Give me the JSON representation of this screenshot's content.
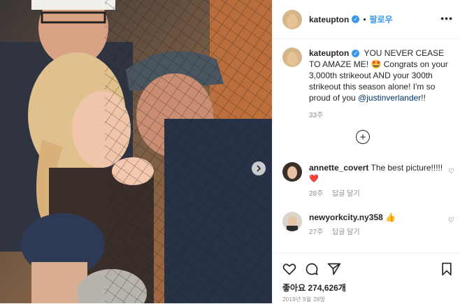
{
  "header": {
    "username": "kateupton",
    "verified_icon": "verified-badge-icon",
    "follow_label": "팔로우",
    "more_icon": "more-options-icon"
  },
  "caption": {
    "username": "kateupton",
    "text_main": "YOU NEVER CEASE TO AMAZE ME! 🤩 Congrats on your 3,000th strikeout AND your 300th strikeout this season alone! I'm so proud of you ",
    "mention": "@justinverlander",
    "text_end": "!!",
    "age": "33주"
  },
  "load_more_icon": "plus-circle-icon",
  "comments": [
    {
      "username": "annette_covert",
      "text": "The best picture!!!!!",
      "emoji": "❤️",
      "age": "28주",
      "reply_label": "답글 달기"
    },
    {
      "username": "newyorkcity.ny358",
      "text": "👍",
      "age": "27주",
      "reply_label": "답글 달기"
    }
  ],
  "actions": {
    "like_icon": "heart-icon",
    "comment_icon": "comment-icon",
    "share_icon": "share-icon",
    "save_icon": "bookmark-icon"
  },
  "likes": {
    "label": "좋아요",
    "count": "274,626개"
  },
  "date": "2019년 9월 28일",
  "colors": {
    "link": "#3897f0",
    "mention": "#003569",
    "meta": "#8e8e8e",
    "text": "#262626"
  }
}
